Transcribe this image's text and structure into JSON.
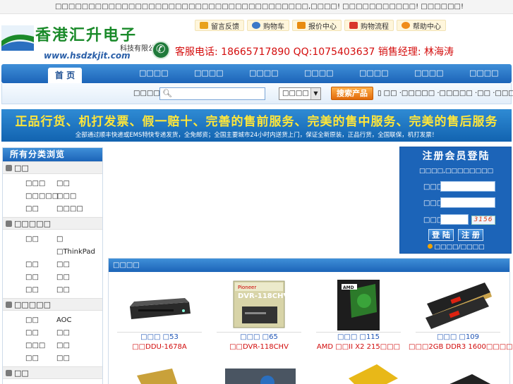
{
  "topbar": {
    "notice": "□□□□□□□□□□□□□□□□□□□□□□□□□□□□□□□□□□□□□□,□□□□!  □□□□□□□□□□□!  □□□□□□!"
  },
  "logo": {
    "cn": "香港汇升电子",
    "company": "科技有限公司",
    "url": "www.hsdzkjit.com"
  },
  "quick_links": [
    {
      "label": "留言反馈",
      "color": "#e9a21b"
    },
    {
      "label": "购物车",
      "color": "#3b78c8"
    },
    {
      "label": "报价中心",
      "color": "#e88b10"
    },
    {
      "label": "购物流程",
      "color": "#d9372b"
    },
    {
      "label": "帮助中心",
      "color": "#f08c1a"
    }
  ],
  "service": {
    "line": "客服电话: 18665717890  QQ:1075403637   销售经理: 林海涛"
  },
  "nav": {
    "home": "首 页",
    "items": [
      "□□□□",
      "□□□□",
      "□□□□",
      "□□□□",
      "□□□□",
      "□□□□",
      "□□□□"
    ]
  },
  "search": {
    "label": "□□□□□",
    "placeholder": "",
    "select_value": "□□□□",
    "button": "搜索产品",
    "hot_words": "▯ □□  ·□□□□□  ·□□□□□  ·□□  ·□□□□  ▯"
  },
  "banner": {
    "main": "正品行货、机打发票、假一赔十、完善的售前服务、完美的售中服务、完美的售后服务",
    "sub": "全部通过顺丰快递或EMS特快专递发货，全免邮资；全国主要城市24小时内送货上门，保证全新原装，正品行货，全国联保，机打发票！"
  },
  "categories": {
    "title": "所有分类浏览",
    "groups": [
      {
        "name": "□□",
        "items": [
          "□□□",
          "□□",
          "□□□□□",
          "□□□",
          "□□",
          "□□□□"
        ]
      },
      {
        "name": "□□□□□",
        "items": [
          "□□",
          "□",
          "",
          "□ThinkPad",
          "□□",
          "□□",
          "□□",
          "□□",
          "□□",
          "□□"
        ]
      },
      {
        "name": "□□□□□",
        "items": [
          "□□",
          "AOC",
          "□□",
          "□□",
          "□□□",
          "□□",
          "□□",
          "□□"
        ]
      },
      {
        "name": "□□",
        "items": []
      }
    ]
  },
  "member": {
    "title": "注册会员登陆",
    "welcome": "□□□□,□□□□□□□□",
    "username_label": "□□□□",
    "password_label": "□□□□",
    "captcha_label": "□□□□",
    "captcha": "3156",
    "login": "登 陆",
    "register": "注 册",
    "forgot": "□□□□/□□□□"
  },
  "products": {
    "title": "□□□□",
    "items": [
      {
        "price": "□□□ □53",
        "name": "□□DDU-1678A",
        "kind": "dvd-drive"
      },
      {
        "price": "□□□ □65",
        "name": "□□DVR-118CHV",
        "kind": "dvd-box"
      },
      {
        "price": "□□□ □115",
        "name": "AMD □□II X2 215□□□",
        "kind": "cpu-box"
      },
      {
        "price": "□□□ □109",
        "name": "□□□2GB DDR3 1600□□□□□",
        "kind": "ram"
      }
    ],
    "pioneer_label": "DVR-118CHV",
    "pioneer_brand": "Pioneer"
  }
}
